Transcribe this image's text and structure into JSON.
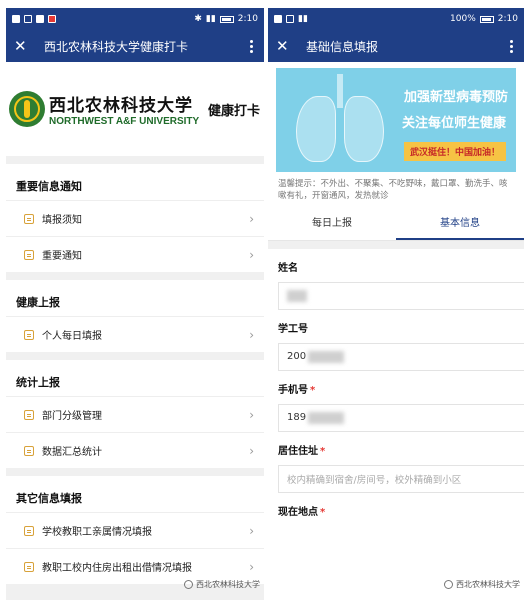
{
  "left": {
    "status": {
      "time": "2:10"
    },
    "titlebar": {
      "title": "西北农林科技大学健康打卡"
    },
    "banner": {
      "name_cn": "西北农林科技大学",
      "name_en": "NORTHWEST A&F UNIVERSITY",
      "tag": "健康打卡"
    },
    "sections": [
      {
        "title": "重要信息通知",
        "items": [
          "填报须知",
          "重要通知"
        ]
      },
      {
        "title": "健康上报",
        "items": [
          "个人每日填报"
        ]
      },
      {
        "title": "统计上报",
        "items": [
          "部门分级管理",
          "数据汇总统计"
        ]
      },
      {
        "title": "其它信息填报",
        "items": [
          "学校教职工亲属情况填报",
          "教职工校内住房出租出借情况填报"
        ]
      }
    ],
    "watermark": "西北农林科技大学"
  },
  "right": {
    "status": {
      "battery": "100%",
      "time": "2:10"
    },
    "titlebar": {
      "title": "基础信息填报"
    },
    "poster": {
      "line1": "加强新型病毒预防",
      "line2": "关注每位师生健康",
      "line3": "武汉挺住！中国加油！"
    },
    "tip": "温馨提示：不外出、不聚集、不吃野味，戴口罩、勤洗手、咳嗽有礼，开窗通风，发热就诊",
    "tabs": [
      "每日上报",
      "基本信息"
    ],
    "fields": {
      "name_label": "姓名",
      "id_label": "学工号",
      "id_value": "200",
      "phone_label": "手机号",
      "phone_value": "189",
      "address_label": "居住住址",
      "address_placeholder": "校内精确到宿舍/房间号，校外精确到小区",
      "location_label": "现在地点"
    },
    "watermark": "西北农林科技大学"
  }
}
